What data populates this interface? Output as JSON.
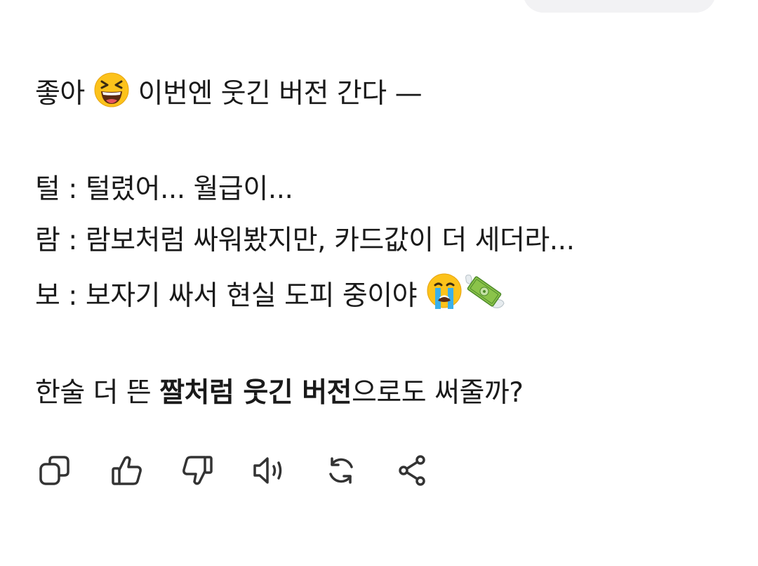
{
  "message": {
    "intro": {
      "prefix": "좋아 ",
      "emoji": "laughing-face-emoji",
      "suffix": " 이번엔 웃긴 버전 간다 —"
    },
    "lines": [
      {
        "initial": "털",
        "separator": " : ",
        "text": "털렸어... 월급이..."
      },
      {
        "initial": "람",
        "separator": " : ",
        "text": "람보처럼 싸워봤지만, 카드값이 더 세더라..."
      },
      {
        "initial": "보",
        "separator": " : ",
        "text": "보자기 싸서 현실 도피 중이야 ",
        "emojis": [
          "crying-face-emoji",
          "money-with-wings-emoji"
        ]
      }
    ],
    "closing": {
      "pre": "한술 더 뜬 ",
      "bold": "짤처럼 웃긴 버전",
      "post": "으로도 써줄까?"
    }
  },
  "actions": [
    {
      "name": "copy-icon"
    },
    {
      "name": "thumbs-up-icon"
    },
    {
      "name": "thumbs-down-icon"
    },
    {
      "name": "speaker-icon"
    },
    {
      "name": "regenerate-icon"
    },
    {
      "name": "share-icon"
    }
  ],
  "colors": {
    "text": "#1a1a1a",
    "icon": "#333333",
    "bubble": "#f2f2f4"
  }
}
